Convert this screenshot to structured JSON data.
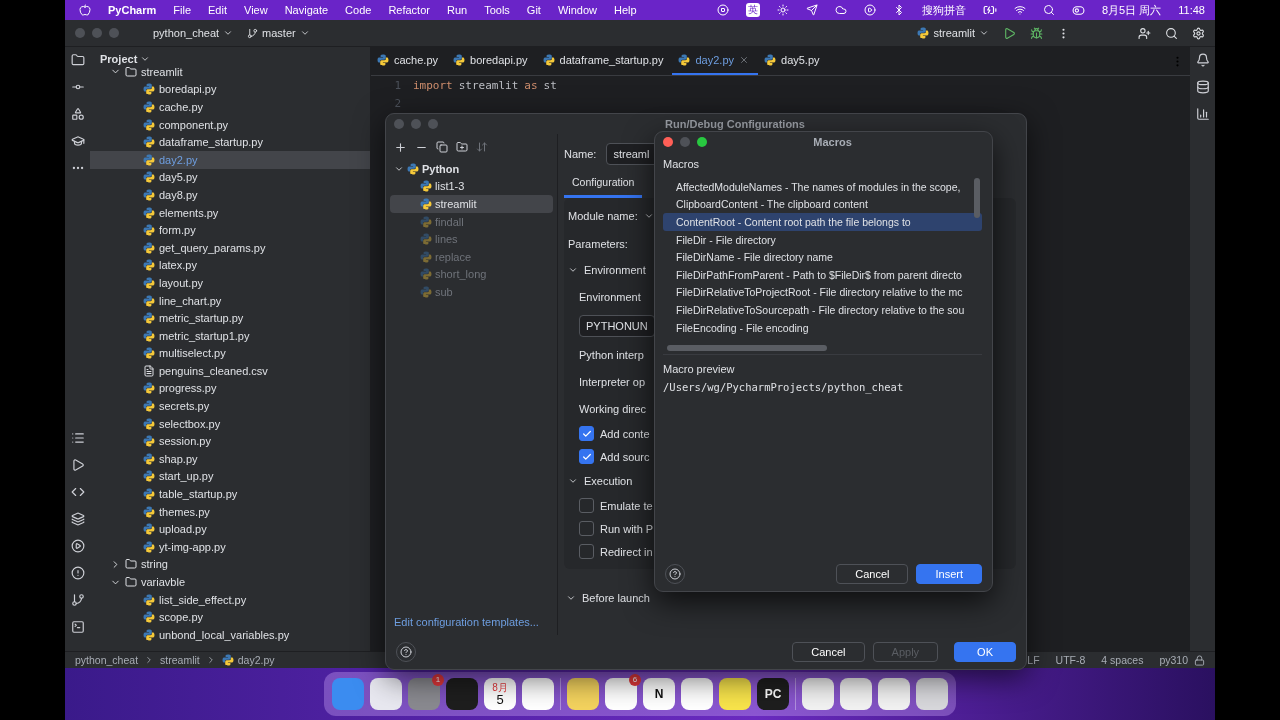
{
  "menubar": {
    "app": "PyCharm",
    "menus": [
      "File",
      "Edit",
      "View",
      "Navigate",
      "Code",
      "Refactor",
      "Run",
      "Tools",
      "Git",
      "Window",
      "Help"
    ],
    "input_badge": "英",
    "input_method": "搜狗拼音",
    "date": "8月5日 周六",
    "time": "11:48"
  },
  "toolbar": {
    "project": "python_cheat",
    "branch": "master",
    "run_config": "streamlit"
  },
  "project_panel": {
    "title": "Project",
    "tree": [
      {
        "name": "streamlit",
        "kind": "folder",
        "expanded": true,
        "children": [
          {
            "name": "boredapi.py",
            "kind": "python",
            "selected": false
          },
          {
            "name": "cache.py",
            "kind": "python",
            "selected": false
          },
          {
            "name": "component.py",
            "kind": "python",
            "selected": false
          },
          {
            "name": "dataframe_startup.py",
            "kind": "python",
            "selected": false
          },
          {
            "name": "day2.py",
            "kind": "python",
            "selected": true
          },
          {
            "name": "day5.py",
            "kind": "python",
            "selected": false
          },
          {
            "name": "day8.py",
            "kind": "python",
            "selected": false
          },
          {
            "name": "elements.py",
            "kind": "python",
            "selected": false
          },
          {
            "name": "form.py",
            "kind": "python",
            "selected": false
          },
          {
            "name": "get_query_params.py",
            "kind": "python",
            "selected": false
          },
          {
            "name": "latex.py",
            "kind": "python",
            "selected": false
          },
          {
            "name": "layout.py",
            "kind": "python",
            "selected": false
          },
          {
            "name": "line_chart.py",
            "kind": "python",
            "selected": false
          },
          {
            "name": "metric_startup.py",
            "kind": "python",
            "selected": false
          },
          {
            "name": "metric_startup1.py",
            "kind": "python",
            "selected": false
          },
          {
            "name": "multiselect.py",
            "kind": "python",
            "selected": false
          },
          {
            "name": "penguins_cleaned.csv",
            "kind": "text",
            "selected": false
          },
          {
            "name": "progress.py",
            "kind": "python",
            "selected": false
          },
          {
            "name": "secrets.py",
            "kind": "python",
            "selected": false
          },
          {
            "name": "selectbox.py",
            "kind": "python",
            "selected": false
          },
          {
            "name": "session.py",
            "kind": "python",
            "selected": false
          },
          {
            "name": "shap.py",
            "kind": "python",
            "selected": false
          },
          {
            "name": "start_up.py",
            "kind": "python",
            "selected": false
          },
          {
            "name": "table_startup.py",
            "kind": "python",
            "selected": false
          },
          {
            "name": "themes.py",
            "kind": "python",
            "selected": false
          },
          {
            "name": "upload.py",
            "kind": "python",
            "selected": false
          },
          {
            "name": "yt-img-app.py",
            "kind": "python",
            "selected": false
          }
        ]
      },
      {
        "name": "string",
        "kind": "folder",
        "expanded": false
      },
      {
        "name": "variavble",
        "kind": "folder",
        "expanded": true,
        "children": [
          {
            "name": "list_side_effect.py",
            "kind": "python",
            "selected": false
          },
          {
            "name": "scope.py",
            "kind": "python",
            "selected": false
          },
          {
            "name": "unbond_local_variables.py",
            "kind": "python",
            "selected": false
          }
        ]
      }
    ]
  },
  "editor": {
    "tabs": [
      {
        "label": "cache.py",
        "selected": false
      },
      {
        "label": "boredapi.py",
        "selected": false
      },
      {
        "label": "dataframe_startup.py",
        "selected": false
      },
      {
        "label": "day2.py",
        "selected": true
      },
      {
        "label": "day5.py",
        "selected": false
      }
    ],
    "lines": [
      {
        "number": "1",
        "tokens": [
          {
            "text": "import",
            "kind": "keyword"
          },
          {
            "text": "streamlit",
            "kind": "plain"
          },
          {
            "text": "as",
            "kind": "keyword"
          },
          {
            "text": "st",
            "kind": "plain"
          }
        ]
      },
      {
        "number": "2"
      }
    ]
  },
  "run_dialog": {
    "title": "Run/Debug Configurations",
    "tree": {
      "name": "Python",
      "expanded": true,
      "children": [
        {
          "name": "list1-3",
          "selected": false,
          "temporary": false
        },
        {
          "name": "streamlit",
          "selected": true,
          "temporary": false
        },
        {
          "name": "findall",
          "selected": false,
          "temporary": true
        },
        {
          "name": "lines",
          "selected": false,
          "temporary": true
        },
        {
          "name": "replace",
          "selected": false,
          "temporary": true
        },
        {
          "name": "short_long",
          "selected": false,
          "temporary": true
        },
        {
          "name": "sub",
          "selected": false,
          "temporary": true
        }
      ]
    },
    "templates_link": "Edit configuration templates...",
    "name_label": "Name:",
    "name_value": "streaml",
    "tabs": [
      {
        "label": "Configuration",
        "selected": true
      }
    ],
    "form": [
      {
        "kind": "dropdown-label",
        "text": "Module name:"
      },
      {
        "kind": "label",
        "text": "Parameters:"
      },
      {
        "kind": "section",
        "text": "Environment",
        "expanded": true,
        "children": [
          {
            "kind": "label",
            "text": "Environment"
          },
          {
            "kind": "field",
            "text": "PYTHONUN"
          },
          {
            "kind": "label",
            "text": "Python interp"
          },
          {
            "kind": "label",
            "text": "Interpreter op"
          },
          {
            "kind": "label",
            "text": "Working direc"
          },
          {
            "kind": "checkbox",
            "text": "Add conte",
            "checked": true
          },
          {
            "kind": "checkbox",
            "text": "Add sourc",
            "checked": true
          }
        ]
      },
      {
        "kind": "section",
        "text": "Execution",
        "expanded": true,
        "children": [
          {
            "kind": "checkbox",
            "text": "Emulate te",
            "checked": false
          },
          {
            "kind": "checkbox",
            "text": "Run with P",
            "checked": false
          },
          {
            "kind": "checkbox",
            "text": "Redirect in",
            "checked": false
          }
        ]
      }
    ],
    "before_launch": {
      "text": "Before launch",
      "expanded": true
    },
    "buttons": [
      {
        "label": "Cancel",
        "kind": "secondary",
        "disabled": false
      },
      {
        "label": "Apply",
        "kind": "secondary",
        "disabled": true
      },
      {
        "label": "OK",
        "kind": "primary",
        "disabled": false
      }
    ]
  },
  "macros_dialog": {
    "title": "Macros",
    "list_label": "Macros",
    "items": [
      {
        "text": "AffectedModuleNames - The names of modules in the scope,",
        "selected": false
      },
      {
        "text": "ClipboardContent - The clipboard content",
        "selected": false
      },
      {
        "text": "ContentRoot - Content root path the file belongs to",
        "selected": true
      },
      {
        "text": "FileDir - File directory",
        "selected": false
      },
      {
        "text": "FileDirName - File directory name",
        "selected": false
      },
      {
        "text": "FileDirPathFromParent - Path to $FileDir$ from parent directo",
        "selected": false
      },
      {
        "text": "FileDirRelativeToProjectRoot - File directory relative to the mc",
        "selected": false
      },
      {
        "text": "FileDirRelativeToSourcepath - File directory relative to the sou",
        "selected": false
      },
      {
        "text": "FileEncoding - File encoding",
        "selected": false
      }
    ],
    "preview_label": "Macro preview",
    "preview": "/Users/wg/PycharmProjects/python_cheat",
    "buttons": [
      {
        "label": "Cancel",
        "kind": "secondary"
      },
      {
        "label": "Insert",
        "kind": "primary"
      }
    ]
  },
  "status_bar": {
    "breadcrumbs": [
      "python_cheat",
      "streamlit",
      "day2.py"
    ],
    "items": [
      "LF",
      "UTF-8",
      "4 spaces",
      "py310"
    ]
  },
  "dock": {
    "items": [
      {
        "kind": "finder",
        "color": "#3b8cf0"
      },
      {
        "kind": "launchpad",
        "color": "#e8e8f0"
      },
      {
        "kind": "settings",
        "color": "#8a8a90",
        "badge": "1"
      },
      {
        "kind": "terminal",
        "color": "#1e1e1e"
      },
      {
        "kind": "calendar",
        "color": "#ffffff",
        "month": "8月",
        "day": "5"
      },
      {
        "kind": "chrome",
        "color": "#ffffff"
      },
      {
        "kind": "separator"
      },
      {
        "kind": "notes",
        "color": "#f4d35e"
      },
      {
        "kind": "store",
        "color": "#ffffff",
        "badge": "6"
      },
      {
        "kind": "notion",
        "color": "#ffffff",
        "letter": "N"
      },
      {
        "kind": "ring",
        "color": "#ffffff"
      },
      {
        "kind": "music",
        "color": "#f8e44b"
      },
      {
        "kind": "pycharm",
        "color": "#1e1e1e",
        "letter": "PC"
      },
      {
        "kind": "separator"
      },
      {
        "kind": "window",
        "color": "#f2f2f2"
      },
      {
        "kind": "window",
        "color": "#f2f2f2"
      },
      {
        "kind": "window",
        "color": "#f2f2f2"
      },
      {
        "kind": "trash",
        "color": "#d8d8dc"
      }
    ]
  }
}
